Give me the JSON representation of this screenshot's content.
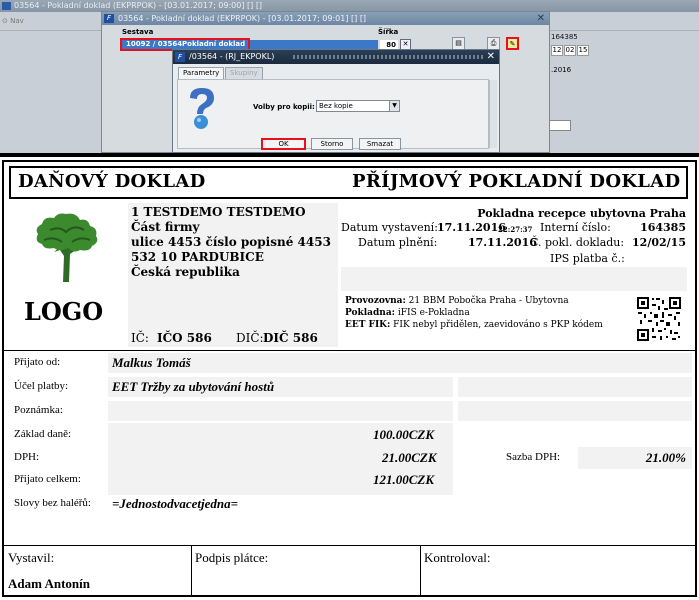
{
  "bg_window": {
    "title": "03564 - Pokladní doklad (EKPRPOK) - [03.01.2017; 09:00] [] []",
    "nav": "Nav"
  },
  "main_window": {
    "title": "03564 - Pokladní doklad (EKPRPOK) - [03.01.2017; 09:01] [] []",
    "col_sestava": "Sestava",
    "col_sirka": "Šířka",
    "selected_id": "10092 / 03564",
    "selected_name": "Pokladní doklad",
    "sirka_value": "80",
    "right_number": "164385",
    "right_boxes": [
      "12",
      "02",
      "15"
    ],
    "right_year": "2016"
  },
  "dialog": {
    "title": "/03564 - (RJ_EKPOKL)",
    "tabs": [
      "Parametry",
      "Skupiny"
    ],
    "volby_label": "Volby pro kopii:",
    "volby_value": "Bez kopie",
    "buttons": {
      "ok": "OK",
      "storno": "Storno",
      "smazat": "Smazat"
    }
  },
  "doc": {
    "header_left": "DAŇOVÝ DOKLAD",
    "header_right": "PŘÍJMOVÝ POKLADNÍ DOKLAD",
    "logo_text": "LOGO",
    "company": {
      "name": "1 TESTDEMO TESTDEMO",
      "part": "Část firmy",
      "street": "ulice 4453 číslo popisné 4453",
      "city": "532 10 PARDUBICE",
      "country": "Česká republika",
      "ic_label": "IČ:",
      "ic_value": "IČO 586",
      "dic_label": "DIČ:",
      "dic_value": "DIČ 586"
    },
    "pokladna": "Pokladna recepce ubytovna Praha",
    "datum_vystaveni_label": "Datum vystavení:",
    "datum_vystaveni": "17.11.2016",
    "datum_vystaveni_time": "22:27:37",
    "interni_cislo_label": "Interní číslo:",
    "interni_cislo": "164385",
    "datum_plneni_label": "Datum plnění:",
    "datum_plneni": "17.11.2016",
    "cislo_pokl_label": "Č. pokl. dokladu:",
    "cislo_pokl": "12/02/15",
    "ips_label": "IPS platba č.:",
    "provozovna_label": "Provozovna:",
    "provozovna_value": "21 BBM Pobočka Praha - Ubytovna",
    "pokladna_label": "Pokladna:",
    "pokladna_value": "iFIS e-Pokladna",
    "eet_label": "EET FIK:",
    "eet_value": "FIK nebyl přidělen, zaevidováno s PKP kódem",
    "prijato_od_label": "Přijato od:",
    "prijato_od": "Malkus Tomáš",
    "ucel_label": "Účel platby:",
    "ucel": "EET Tržby za ubytování hostů",
    "poznamka_label": "Poznámka:",
    "zaklad_label": "Základ daně:",
    "zaklad": "100.00",
    "dph_label": "DPH:",
    "dph": "21.00",
    "celkem_label": "Přijato celkem:",
    "celkem": "121.00",
    "currency": "CZK",
    "sazba_label": "Sazba DPH:",
    "sazba": "21.00%",
    "slovy_label": "Slovy bez haléřů:",
    "slovy": "=Jednostodvacetjedna=",
    "vystavil_label": "Vystavil:",
    "vystavil": "Adam Antonín",
    "podpis_label": "Podpis plátce:",
    "kontroloval_label": "Kontroloval:"
  }
}
